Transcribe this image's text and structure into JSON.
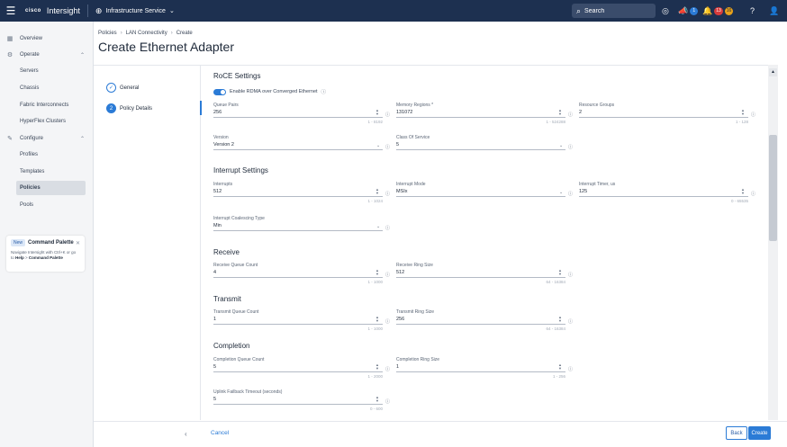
{
  "topbar": {
    "logo": "cisco",
    "brand": "Intersight",
    "service": "Infrastructure Service",
    "search_placeholder": "Search",
    "notif_count": "1",
    "alarm_critical": "13",
    "alarm_warning": "16",
    "icons": [
      "menu-icon",
      "globe-icon",
      "search-icon",
      "check-circle-icon",
      "megaphone-icon",
      "bell-icon",
      "help-icon",
      "user-icon"
    ]
  },
  "sidebar": {
    "items": [
      {
        "label": "Overview",
        "icon": "overview-icon"
      },
      {
        "label": "Operate",
        "icon": "operate-icon"
      },
      {
        "label": "Servers"
      },
      {
        "label": "Chassis"
      },
      {
        "label": "Fabric Interconnects"
      },
      {
        "label": "HyperFlex Clusters"
      },
      {
        "label": "Configure",
        "icon": "configure-icon"
      },
      {
        "label": "Profiles"
      },
      {
        "label": "Templates"
      },
      {
        "label": "Policies"
      },
      {
        "label": "Pools"
      }
    ],
    "command_palette": {
      "badge": "New",
      "title": "Command Palette",
      "desc_1": "Navigate Intersight with Ctrl+K or go",
      "desc_2_pre": "to ",
      "desc_2_b1": "Help",
      "desc_2_mid": " > ",
      "desc_2_b2": "Command Palette"
    }
  },
  "breadcrumb": [
    "Policies",
    "LAN Connectivity",
    "Create"
  ],
  "page_title": "Create Ethernet Adapter",
  "steps": [
    {
      "label": "General",
      "mark": "✓"
    },
    {
      "label": "Policy Details",
      "mark": "2"
    }
  ],
  "form": {
    "roce": {
      "title": "RoCE Settings",
      "toggle_label": "Enable RDMA over Converged Ethernet",
      "queue_pairs": {
        "label": "Queue Pairs",
        "value": "256",
        "range": "1 - 8192"
      },
      "memory_regions": {
        "label": "Memory Regions *",
        "value": "131072",
        "range": "1 - 524288"
      },
      "resource_groups": {
        "label": "Resource Groups",
        "value": "2",
        "range": "1 - 128"
      },
      "version": {
        "label": "Version",
        "value": "Version 2"
      },
      "class_of_service": {
        "label": "Class Of Service",
        "value": "5"
      }
    },
    "interrupt": {
      "title": "Interrupt Settings",
      "interrupts": {
        "label": "Interrupts",
        "value": "512",
        "range": "1 - 1024"
      },
      "interrupt_mode": {
        "label": "Interrupt Mode",
        "value": "MSIx"
      },
      "interrupt_timer": {
        "label": "Interrupt Timer, us",
        "value": "125",
        "range": "0 - 65535"
      },
      "coalescing_type": {
        "label": "Interrupt Coalescing Type",
        "value": "Min"
      }
    },
    "receive": {
      "title": "Receive",
      "queue_count": {
        "label": "Receive Queue Count",
        "value": "4",
        "range": "1 - 1000"
      },
      "ring_size": {
        "label": "Receive Ring Size",
        "value": "512",
        "range": "64 - 16384"
      }
    },
    "transmit": {
      "title": "Transmit",
      "queue_count": {
        "label": "Transmit Queue Count",
        "value": "1",
        "range": "1 - 1000"
      },
      "ring_size": {
        "label": "Transmit Ring Size",
        "value": "256",
        "range": "64 - 16384"
      }
    },
    "completion": {
      "title": "Completion",
      "queue_count": {
        "label": "Completion Queue Count",
        "value": "5",
        "range": "1 - 2000"
      },
      "ring_size": {
        "label": "Completion Ring Size",
        "value": "1",
        "range": "1 - 256"
      },
      "uplink_timeout": {
        "label": "Uplink Failback Timeout (seconds)",
        "value": "5",
        "range": "0 - 600"
      }
    }
  },
  "footer": {
    "cancel": "Cancel",
    "back": "Back",
    "create": "Create"
  },
  "colors": {
    "header_bg": "#1d3050",
    "accent": "#2b7bd6",
    "critical": "#d63b3b",
    "warning": "#e6a11b"
  }
}
